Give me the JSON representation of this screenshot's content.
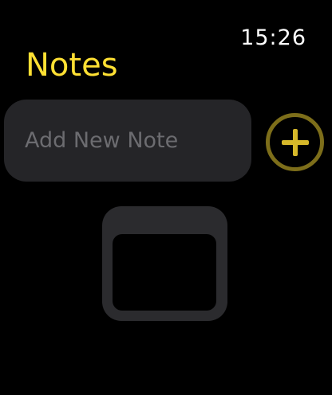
{
  "status_bar": {
    "time": "15:26"
  },
  "app": {
    "title": "Notes",
    "accent_color": "#ffe033"
  },
  "new_note": {
    "placeholder": "Add New Note",
    "value": "",
    "add_button_icon": "plus-circle-icon"
  },
  "empty_state": {
    "icon": "note-window-icon"
  }
}
